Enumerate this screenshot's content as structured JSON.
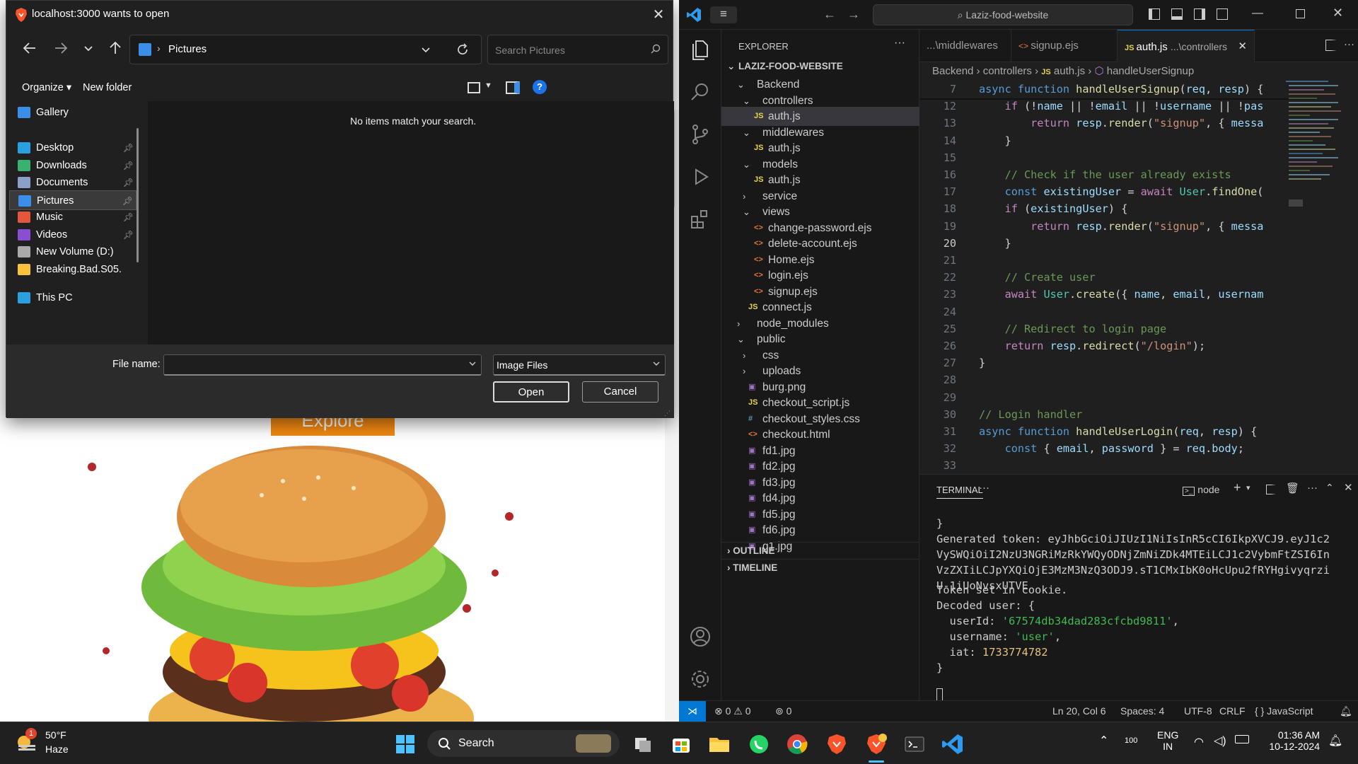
{
  "dialog": {
    "title": "localhost:3000 wants to open",
    "breadcrumb_location": "Pictures",
    "search_placeholder": "Search Pictures",
    "organize_label": "Organize",
    "new_folder_label": "New folder",
    "empty_message": "No items match your search.",
    "nav_items": [
      {
        "label": "Gallery",
        "pinned": false
      },
      {
        "label": "Desktop",
        "pinned": true
      },
      {
        "label": "Downloads",
        "pinned": true
      },
      {
        "label": "Documents",
        "pinned": true
      },
      {
        "label": "Pictures",
        "pinned": true,
        "selected": true
      },
      {
        "label": "Music",
        "pinned": true
      },
      {
        "label": "Videos",
        "pinned": true
      },
      {
        "label": "New Volume (D:)",
        "pinned": false
      },
      {
        "label": "Breaking.Bad.S05.",
        "pinned": false
      },
      {
        "label": "This PC",
        "pinned": false
      }
    ],
    "file_name_label": "File name:",
    "file_name_value": "",
    "file_type_value": "Image Files",
    "open_label": "Open",
    "cancel_label": "Cancel"
  },
  "page": {
    "explore_label": "Explore"
  },
  "vscode": {
    "search_text": "Laziz-food-website",
    "explorer_title": "EXPLORER",
    "project_name": "LAZIZ-FOOD-WEBSITE",
    "tree": [
      {
        "label": "Backend",
        "type": "folder",
        "open": true,
        "depth": 1
      },
      {
        "label": "controllers",
        "type": "folder",
        "open": true,
        "depth": 2
      },
      {
        "label": "auth.js",
        "type": "js",
        "depth": 3,
        "selected": true
      },
      {
        "label": "middlewares",
        "type": "folder",
        "open": true,
        "depth": 2
      },
      {
        "label": "auth.js",
        "type": "js",
        "depth": 3
      },
      {
        "label": "models",
        "type": "folder",
        "open": true,
        "depth": 2
      },
      {
        "label": "auth.js",
        "type": "js",
        "depth": 3
      },
      {
        "label": "service",
        "type": "folder",
        "open": false,
        "depth": 2
      },
      {
        "label": "views",
        "type": "folder",
        "open": true,
        "depth": 2
      },
      {
        "label": "change-password.ejs",
        "type": "ejs",
        "depth": 3
      },
      {
        "label": "delete-account.ejs",
        "type": "ejs",
        "depth": 3
      },
      {
        "label": "Home.ejs",
        "type": "ejs",
        "depth": 3
      },
      {
        "label": "login.ejs",
        "type": "ejs",
        "depth": 3
      },
      {
        "label": "signup.ejs",
        "type": "ejs",
        "depth": 3
      },
      {
        "label": "connect.js",
        "type": "js",
        "depth": 2
      },
      {
        "label": "node_modules",
        "type": "folder",
        "open": false,
        "depth": 1
      },
      {
        "label": "public",
        "type": "folder",
        "open": true,
        "depth": 1
      },
      {
        "label": "css",
        "type": "folder",
        "open": false,
        "depth": 2
      },
      {
        "label": "uploads",
        "type": "folder",
        "open": false,
        "depth": 2
      },
      {
        "label": "burg.png",
        "type": "img",
        "depth": 2
      },
      {
        "label": "checkout_script.js",
        "type": "js",
        "depth": 2
      },
      {
        "label": "checkout_styles.css",
        "type": "css",
        "depth": 2
      },
      {
        "label": "checkout.html",
        "type": "html",
        "depth": 2
      },
      {
        "label": "fd1.jpg",
        "type": "img",
        "depth": 2
      },
      {
        "label": "fd2.jpg",
        "type": "img",
        "depth": 2
      },
      {
        "label": "fd3.jpg",
        "type": "img",
        "depth": 2
      },
      {
        "label": "fd4.jpg",
        "type": "img",
        "depth": 2
      },
      {
        "label": "fd5.jpg",
        "type": "img",
        "depth": 2
      },
      {
        "label": "fd6.jpg",
        "type": "img",
        "depth": 2
      },
      {
        "label": "g1.jpg",
        "type": "img",
        "depth": 2
      }
    ],
    "outline_label": "OUTLINE",
    "timeline_label": "TIMELINE",
    "tabs": [
      {
        "label": "...\\middlewares",
        "icon": "",
        "active": false
      },
      {
        "label": "signup.ejs",
        "icon": "<>",
        "active": false
      },
      {
        "label": "auth.js",
        "detail": "...\\controllers",
        "icon": "JS",
        "active": true
      }
    ],
    "breadcrumb": [
      "Backend",
      "controllers",
      "auth.js",
      "handleUserSignup"
    ],
    "code_lines": [
      {
        "n": "7",
        "tokens": [
          [
            "kw",
            "async "
          ],
          [
            "kw",
            "function "
          ],
          [
            "fn",
            "handleUserSignup"
          ],
          [
            "pn",
            "("
          ],
          [
            "vr",
            "req"
          ],
          [
            "pn",
            ", "
          ],
          [
            "vr",
            "resp"
          ],
          [
            "pn",
            ") {"
          ]
        ]
      },
      {
        "n": "12",
        "tokens": [
          [
            "pn",
            "    "
          ],
          [
            "ctl",
            "if "
          ],
          [
            "pn",
            "(!"
          ],
          [
            "vr",
            "name"
          ],
          [
            "pn",
            " || !"
          ],
          [
            "vr",
            "email"
          ],
          [
            "pn",
            " || !"
          ],
          [
            "vr",
            "username"
          ],
          [
            "pn",
            " || !"
          ],
          [
            "vr",
            "pas"
          ]
        ]
      },
      {
        "n": "13",
        "tokens": [
          [
            "pn",
            "        "
          ],
          [
            "ctl",
            "return "
          ],
          [
            "vr",
            "resp"
          ],
          [
            "pn",
            "."
          ],
          [
            "fn",
            "render"
          ],
          [
            "pn",
            "("
          ],
          [
            "str",
            "\"signup\""
          ],
          [
            "pn",
            ", { "
          ],
          [
            "vr",
            "messa"
          ]
        ]
      },
      {
        "n": "14",
        "tokens": [
          [
            "pn",
            "    }"
          ]
        ]
      },
      {
        "n": "15",
        "tokens": []
      },
      {
        "n": "16",
        "tokens": [
          [
            "pn",
            "    "
          ],
          [
            "cm",
            "// Check if the user already exists"
          ]
        ]
      },
      {
        "n": "17",
        "tokens": [
          [
            "pn",
            "    "
          ],
          [
            "kw",
            "const "
          ],
          [
            "vr",
            "existingUser"
          ],
          [
            "pn",
            " = "
          ],
          [
            "ctl",
            "await "
          ],
          [
            "cl",
            "User"
          ],
          [
            "pn",
            "."
          ],
          [
            "fn",
            "findOne"
          ],
          [
            "pn",
            "("
          ]
        ]
      },
      {
        "n": "18",
        "tokens": [
          [
            "pn",
            "    "
          ],
          [
            "ctl",
            "if "
          ],
          [
            "pn",
            "("
          ],
          [
            "vr",
            "existingUser"
          ],
          [
            "pn",
            ") {"
          ]
        ]
      },
      {
        "n": "19",
        "tokens": [
          [
            "pn",
            "        "
          ],
          [
            "ctl",
            "return "
          ],
          [
            "vr",
            "resp"
          ],
          [
            "pn",
            "."
          ],
          [
            "fn",
            "render"
          ],
          [
            "pn",
            "("
          ],
          [
            "str",
            "\"signup\""
          ],
          [
            "pn",
            ", { "
          ],
          [
            "vr",
            "messa"
          ]
        ]
      },
      {
        "n": "20",
        "tokens": [
          [
            "pn",
            "    }"
          ]
        ]
      },
      {
        "n": "21",
        "tokens": []
      },
      {
        "n": "22",
        "tokens": [
          [
            "pn",
            "    "
          ],
          [
            "cm",
            "// Create user"
          ]
        ]
      },
      {
        "n": "23",
        "tokens": [
          [
            "pn",
            "    "
          ],
          [
            "ctl",
            "await "
          ],
          [
            "cl",
            "User"
          ],
          [
            "pn",
            "."
          ],
          [
            "fn",
            "create"
          ],
          [
            "pn",
            "({ "
          ],
          [
            "vr",
            "name"
          ],
          [
            "pn",
            ", "
          ],
          [
            "vr",
            "email"
          ],
          [
            "pn",
            ", "
          ],
          [
            "vr",
            "usernam"
          ]
        ]
      },
      {
        "n": "24",
        "tokens": []
      },
      {
        "n": "25",
        "tokens": [
          [
            "pn",
            "    "
          ],
          [
            "cm",
            "// Redirect to login page"
          ]
        ]
      },
      {
        "n": "26",
        "tokens": [
          [
            "pn",
            "    "
          ],
          [
            "ctl",
            "return "
          ],
          [
            "vr",
            "resp"
          ],
          [
            "pn",
            "."
          ],
          [
            "fn",
            "redirect"
          ],
          [
            "pn",
            "("
          ],
          [
            "str",
            "\"/login\""
          ],
          [
            "pn",
            ");"
          ]
        ]
      },
      {
        "n": "27",
        "tokens": [
          [
            "pn",
            "}"
          ]
        ]
      },
      {
        "n": "28",
        "tokens": []
      },
      {
        "n": "29",
        "tokens": []
      },
      {
        "n": "30",
        "tokens": [
          [
            "cm",
            "// Login handler"
          ]
        ]
      },
      {
        "n": "31",
        "tokens": [
          [
            "kw",
            "async "
          ],
          [
            "kw",
            "function "
          ],
          [
            "fn",
            "handleUserLogin"
          ],
          [
            "pn",
            "("
          ],
          [
            "vr",
            "req"
          ],
          [
            "pn",
            ", "
          ],
          [
            "vr",
            "resp"
          ],
          [
            "pn",
            ") {"
          ]
        ]
      },
      {
        "n": "32",
        "tokens": [
          [
            "pn",
            "    "
          ],
          [
            "kw",
            "const "
          ],
          [
            "pn",
            "{ "
          ],
          [
            "vr",
            "email"
          ],
          [
            "pn",
            ", "
          ],
          [
            "vr",
            "password"
          ],
          [
            "pn",
            " } = "
          ],
          [
            "vr",
            "req"
          ],
          [
            "pn",
            "."
          ],
          [
            "vr",
            "body"
          ],
          [
            "pn",
            ";"
          ]
        ]
      },
      {
        "n": "33",
        "tokens": []
      }
    ],
    "terminal_title": "TERMINAL",
    "terminal_shell": "node",
    "terminal_lines": [
      {
        "text": "}",
        "cls": ""
      },
      {
        "text": "Generated token: eyJhbGciOiJIUzI1NiIsInR5cCI6IkpXVCJ9.eyJ1c2VySWQiOiI2NzU3NGRiMzRkYWQyODNjZmNiZDk4MTEiLCJ1c2VybmFtZSI6InVzZXIiLCJpYXQiOjE3MzM3NzQ3ODJ9.sT1CMxIbK0oHcUpu2fRYHgivyqrziU-1iUoNvsxUTVE",
        "cls": ""
      },
      {
        "text": "Token set in cookie.",
        "cls": ""
      },
      {
        "text": "Decoded user: {",
        "cls": ""
      },
      {
        "text": "  userId: '67574db34dad283cfcbd9811',",
        "cls": "obj"
      },
      {
        "text": "  username: 'user',",
        "cls": "obj"
      },
      {
        "text": "  iat: 1733774782",
        "cls": "num"
      },
      {
        "text": "}",
        "cls": ""
      }
    ],
    "status": {
      "errors": "0",
      "warnings": "0",
      "ports": "0",
      "position": "Ln 20, Col 6",
      "spaces": "Spaces: 4",
      "encoding": "UTF-8",
      "eol": "CRLF",
      "language": "JavaScript"
    }
  },
  "taskbar": {
    "weather_temp": "50°F",
    "weather_desc": "Haze",
    "weather_badge": "1",
    "search_label": "Search",
    "battery": "100",
    "lang1": "ENG",
    "lang2": "IN",
    "time": "01:36 AM",
    "date": "10-12-2024"
  },
  "colors": {
    "vscode_accent": "#0078d4",
    "explore_button": "#f28a12",
    "dialog_bg": "#202020"
  }
}
